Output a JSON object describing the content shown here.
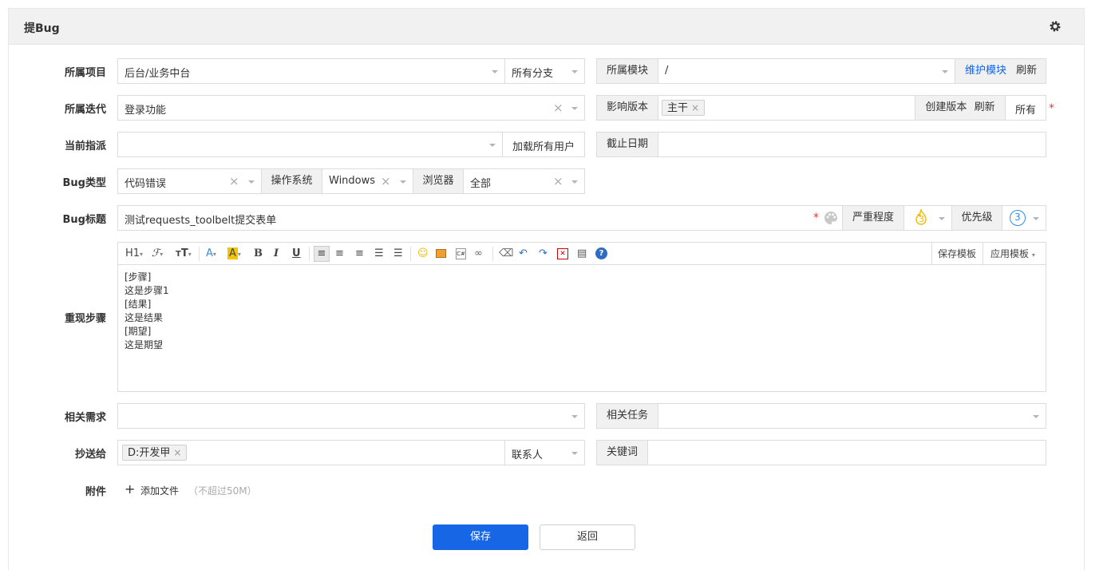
{
  "panel": {
    "title": "提Bug"
  },
  "form": {
    "product": {
      "label": "所属项目",
      "value": "后台/业务中台",
      "branch": "所有分支"
    },
    "module": {
      "label": "所属模块",
      "value": "/",
      "maintain": "维护模块",
      "refresh": "刷新"
    },
    "iteration": {
      "label": "所属迭代",
      "value": "登录功能"
    },
    "build": {
      "label": "影响版本",
      "tag": "主干",
      "create": "创建版本",
      "refresh": "刷新",
      "all": "所有"
    },
    "assign": {
      "label": "当前指派",
      "value": "",
      "load_all": "加载所有用户"
    },
    "deadline": {
      "label": "截止日期",
      "value": ""
    },
    "bug_type": {
      "label": "Bug类型",
      "value": "代码错误",
      "os_label": "操作系统",
      "os_value": "Windows",
      "browser_label": "浏览器",
      "browser_value": "全部"
    },
    "title": {
      "label": "Bug标题",
      "value": "测试requests_toolbelt提交表单",
      "severity_label": "严重程度",
      "severity_value": "3",
      "priority_label": "优先级",
      "priority_value": "3"
    },
    "steps": {
      "label": "重现步骤",
      "lines": [
        "[步骤]",
        "这是步骤1",
        "[结果]",
        "这是结果",
        "[期望]",
        "这是期望"
      ]
    },
    "toolbar": {
      "h1": "H1",
      "save_template": "保存模板",
      "apply_template": "应用模板"
    },
    "story": {
      "label": "相关需求",
      "value": ""
    },
    "task": {
      "label": "相关任务",
      "value": ""
    },
    "mailto": {
      "label": "抄送给",
      "tag": "D:开发甲",
      "contacts": "联系人"
    },
    "keywords": {
      "label": "关键词",
      "value": ""
    },
    "files": {
      "label": "附件",
      "add": "添加文件",
      "hint": "（不超过50M）"
    }
  },
  "actions": {
    "save": "保存",
    "back": "返回"
  },
  "colors": {
    "primary": "#1666e6",
    "link": "#0c64eb",
    "required": "#e4393c",
    "severity": "#f5b800",
    "priority": "#2f8de4"
  }
}
